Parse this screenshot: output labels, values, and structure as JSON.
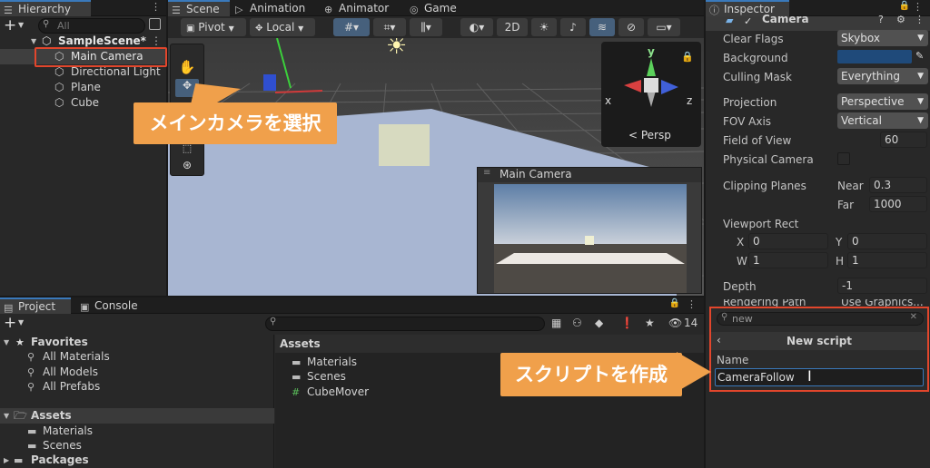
{
  "hierarchy": {
    "tab_label": "Hierarchy",
    "search_placeholder": "All",
    "scene_name": "SampleScene*",
    "items": [
      {
        "label": "Main Camera"
      },
      {
        "label": "Directional Light"
      },
      {
        "label": "Plane"
      },
      {
        "label": "Cube"
      }
    ]
  },
  "scene_tabs": [
    {
      "label": "Scene"
    },
    {
      "label": "Animation"
    },
    {
      "label": "Animator"
    },
    {
      "label": "Game"
    }
  ],
  "scene_toolbar": {
    "pivot": "Pivot",
    "local": "Local",
    "mode_2d": "2D"
  },
  "gizmo": {
    "persp_label": "< Persp",
    "axis_x": "x",
    "axis_y": "y",
    "axis_z": "z"
  },
  "camera_preview": {
    "title": "Main Camera"
  },
  "callouts": {
    "select_main_camera": "メインカメラを選択",
    "create_script": "スクリプトを作成"
  },
  "inspector": {
    "tab_label": "Inspector",
    "component_title": "Camera",
    "clear_flags": {
      "label": "Clear Flags",
      "value": "Skybox"
    },
    "background": {
      "label": "Background",
      "color": "#1f4a7a"
    },
    "culling_mask": {
      "label": "Culling Mask",
      "value": "Everything"
    },
    "projection": {
      "label": "Projection",
      "value": "Perspective"
    },
    "fov_axis": {
      "label": "FOV Axis",
      "value": "Vertical"
    },
    "field_of_view": {
      "label": "Field of View",
      "value": "60"
    },
    "physical_camera": {
      "label": "Physical Camera"
    },
    "clipping_planes": {
      "label": "Clipping Planes",
      "near_label": "Near",
      "near": "0.3",
      "far_label": "Far",
      "far": "1000"
    },
    "viewport_rect": {
      "label": "Viewport Rect",
      "x_label": "X",
      "x": "0",
      "y_label": "Y",
      "y": "0",
      "w_label": "W",
      "w": "1",
      "h_label": "H",
      "h": "1"
    },
    "depth": {
      "label": "Depth",
      "value": "-1"
    },
    "rendering_path_partial": "Rendering Path",
    "rendering_path_value_partial": "Use Graphics..."
  },
  "new_script_popup": {
    "search_value": "new",
    "title": "New script",
    "name_label": "Name",
    "name_value": "CameraFollow"
  },
  "project": {
    "tabs": [
      {
        "label": "Project"
      },
      {
        "label": "Console"
      }
    ],
    "favorites": {
      "label": "Favorites",
      "items": [
        {
          "label": "All Materials"
        },
        {
          "label": "All Models"
        },
        {
          "label": "All Prefabs"
        }
      ]
    },
    "assets": {
      "label": "Assets",
      "items": [
        {
          "label": "Materials"
        },
        {
          "label": "Scenes"
        }
      ]
    },
    "packages_label": "Packages",
    "content_header": "Assets",
    "content_items": [
      {
        "label": "Materials"
      },
      {
        "label": "Scenes"
      },
      {
        "label": "CubeMover"
      }
    ],
    "hidden_count": "14"
  }
}
